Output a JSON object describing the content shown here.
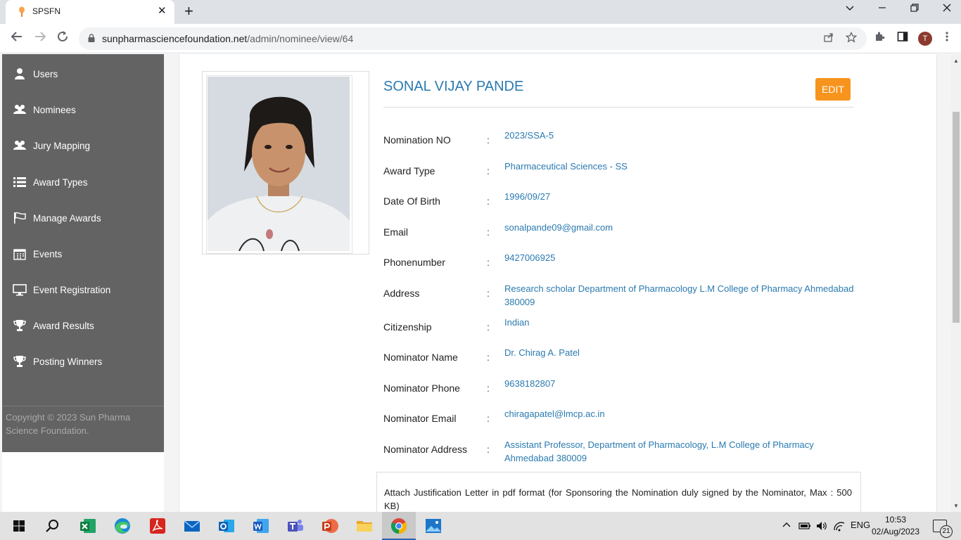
{
  "browser": {
    "tab_title": "SPSFN",
    "tab_close": "✕",
    "new_tab": "+",
    "url_host": "sunpharmasciencefoundation.net",
    "url_path": "/admin/nominee/view/64",
    "profile_initial": "T",
    "window_controls": [
      "⌄",
      "—",
      "❐",
      "✕"
    ]
  },
  "sidebar": {
    "items": [
      {
        "label": "Users",
        "icon": "user-icon"
      },
      {
        "label": "Nominees",
        "icon": "users-icon"
      },
      {
        "label": "Jury Mapping",
        "icon": "users-icon"
      },
      {
        "label": "Award Types",
        "icon": "list-icon"
      },
      {
        "label": "Manage Awards",
        "icon": "flag-icon"
      },
      {
        "label": "Events",
        "icon": "calendar-icon"
      },
      {
        "label": "Event Registration",
        "icon": "desktop-icon"
      },
      {
        "label": "Award Results",
        "icon": "trophy-icon"
      },
      {
        "label": "Posting Winners",
        "icon": "trophy-icon"
      }
    ],
    "copyright": "Copyright © 2023 Sun Pharma Science Foundation."
  },
  "nominee": {
    "name": "SONAL VIJAY PANDE",
    "edit_label": "EDIT",
    "fields": [
      {
        "label": "Nomination NO",
        "value": "2023/SSA-5"
      },
      {
        "label": "Award Type",
        "value": "Pharmaceutical Sciences - SS"
      },
      {
        "label": "Date Of Birth",
        "value": "1996/09/27"
      },
      {
        "label": "Email",
        "value": "sonalpande09@gmail.com"
      },
      {
        "label": "Phonenumber",
        "value": "9427006925"
      },
      {
        "label": "Address",
        "value": "Research scholar Department of Pharmacology L.M College of Pharmacy Ahmedabad 380009"
      },
      {
        "label": "Citizenship",
        "value": "Indian"
      },
      {
        "label": "Nominator Name",
        "value": "Dr. Chirag A. Patel"
      },
      {
        "label": "Nominator Phone",
        "value": "9638182807"
      },
      {
        "label": "Nominator Email",
        "value": "chiragapatel@lmcp.ac.in"
      },
      {
        "label": "Nominator Address",
        "value": "Assistant Professor, Department of Pharmacology, L.M College of Pharmacy Ahmedabad 380009"
      }
    ],
    "colon": ":",
    "attach_text": "Attach Justification Letter in pdf format (for Sponsoring the Nomination duly signed by the Nominator, Max : 500 KB)"
  },
  "taskbar": {
    "time": "10:53",
    "date": "02/Aug/2023",
    "language": "ENG",
    "notification_count": "21"
  },
  "colors": {
    "sidebar_bg": "#636363",
    "accent_blue": "#2a7ab0",
    "edit_orange": "#f7941d"
  }
}
